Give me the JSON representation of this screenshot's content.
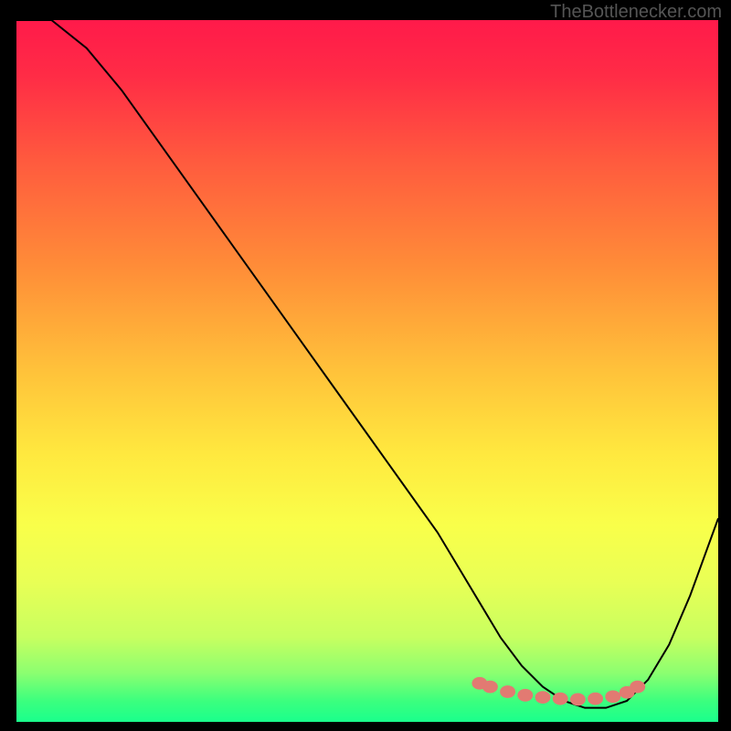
{
  "attribution": "TheBottlenecker.com",
  "chart_data": {
    "type": "line",
    "title": "",
    "xlabel": "",
    "ylabel": "",
    "xlim": [
      0,
      100
    ],
    "ylim": [
      0,
      100
    ],
    "series": [
      {
        "name": "curve",
        "x": [
          0,
          5,
          10,
          15,
          20,
          25,
          30,
          35,
          40,
          45,
          50,
          55,
          60,
          63,
          66,
          69,
          72,
          75,
          78,
          81,
          84,
          87,
          90,
          93,
          96,
          100
        ],
        "y": [
          100,
          100,
          96,
          90,
          83,
          76,
          69,
          62,
          55,
          48,
          41,
          34,
          27,
          22,
          17,
          12,
          8,
          5,
          3,
          2,
          2,
          3,
          6,
          11,
          18,
          29
        ]
      }
    ],
    "dots": {
      "x": [
        66,
        67.5,
        70,
        72.5,
        75,
        77.5,
        80,
        82.5,
        85,
        87,
        88.5
      ],
      "y": [
        5.5,
        5,
        4.3,
        3.8,
        3.5,
        3.3,
        3.2,
        3.3,
        3.6,
        4.2,
        5
      ]
    },
    "gradient_stops": [
      {
        "p": 0.0,
        "c": "#ff1a4a"
      },
      {
        "p": 0.08,
        "c": "#ff2c46"
      },
      {
        "p": 0.2,
        "c": "#ff5a3e"
      },
      {
        "p": 0.35,
        "c": "#ff8c38"
      },
      {
        "p": 0.5,
        "c": "#ffc23a"
      },
      {
        "p": 0.62,
        "c": "#ffe93f"
      },
      {
        "p": 0.72,
        "c": "#f9ff4a"
      },
      {
        "p": 0.8,
        "c": "#e9ff55"
      },
      {
        "p": 0.88,
        "c": "#c7ff60"
      },
      {
        "p": 0.93,
        "c": "#8cff70"
      },
      {
        "p": 0.97,
        "c": "#3cff7e"
      },
      {
        "p": 1.0,
        "c": "#1aff8c"
      }
    ],
    "dot_color": "#e27a72",
    "line_color": "#000000"
  }
}
